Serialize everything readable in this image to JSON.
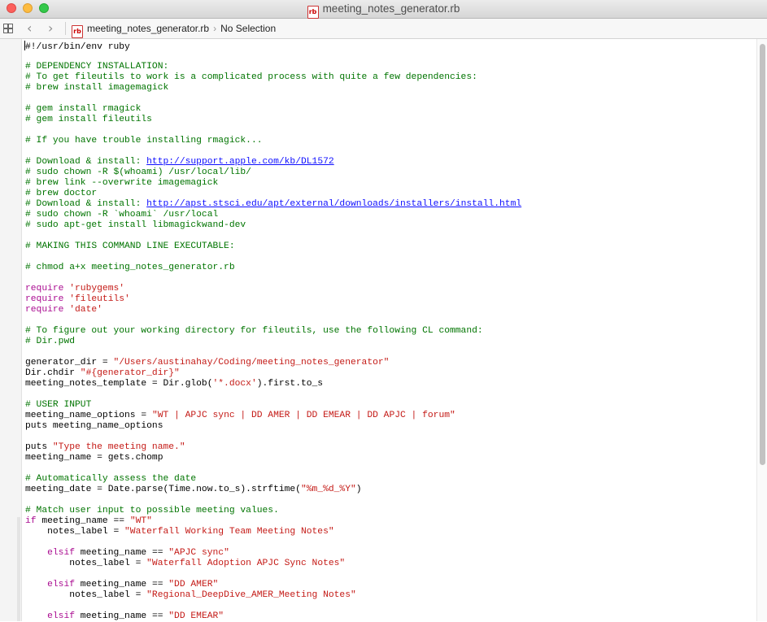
{
  "window": {
    "title": "meeting_notes_generator.rb"
  },
  "jumpbar": {
    "file": "meeting_notes_generator.rb",
    "selection": "No Selection"
  },
  "editor": {
    "lines": [
      [
        {
          "t": "p",
          "v": "#!/usr/bin/env ruby"
        }
      ],
      [],
      [
        {
          "t": "c",
          "v": "# DEPENDENCY INSTALLATION:"
        }
      ],
      [
        {
          "t": "c",
          "v": "# To get fileutils to work is a complicated process with quite a few dependencies:"
        }
      ],
      [
        {
          "t": "c",
          "v": "# brew install imagemagick"
        }
      ],
      [],
      [
        {
          "t": "c",
          "v": "# gem install rmagick"
        }
      ],
      [
        {
          "t": "c",
          "v": "# gem install fileutils"
        }
      ],
      [],
      [
        {
          "t": "c",
          "v": "# If you have trouble installing rmagick..."
        }
      ],
      [],
      [
        {
          "t": "c",
          "v": "# Download & install: "
        },
        {
          "t": "u",
          "v": "http://support.apple.com/kb/DL1572"
        }
      ],
      [
        {
          "t": "c",
          "v": "# sudo chown -R $(whoami) /usr/local/lib/"
        }
      ],
      [
        {
          "t": "c",
          "v": "# brew link --overwrite imagemagick"
        }
      ],
      [
        {
          "t": "c",
          "v": "# brew doctor"
        }
      ],
      [
        {
          "t": "c",
          "v": "# Download & install: "
        },
        {
          "t": "u",
          "v": "http://apst.stsci.edu/apt/external/downloads/installers/install.html"
        }
      ],
      [
        {
          "t": "c",
          "v": "# sudo chown -R `whoami` /usr/local"
        }
      ],
      [
        {
          "t": "c",
          "v": "# sudo apt-get install libmagickwand-dev"
        }
      ],
      [],
      [
        {
          "t": "c",
          "v": "# MAKING THIS COMMAND LINE EXECUTABLE:"
        }
      ],
      [],
      [
        {
          "t": "c",
          "v": "# chmod a+x meeting_notes_generator.rb"
        }
      ],
      [],
      [
        {
          "t": "k",
          "v": "require"
        },
        {
          "t": "p",
          "v": " "
        },
        {
          "t": "s",
          "v": "'rubygems'"
        }
      ],
      [
        {
          "t": "k",
          "v": "require"
        },
        {
          "t": "p",
          "v": " "
        },
        {
          "t": "s",
          "v": "'fileutils'"
        }
      ],
      [
        {
          "t": "k",
          "v": "require"
        },
        {
          "t": "p",
          "v": " "
        },
        {
          "t": "s",
          "v": "'date'"
        }
      ],
      [],
      [
        {
          "t": "c",
          "v": "# To figure out your working directory for fileutils, use the following CL command:"
        }
      ],
      [
        {
          "t": "c",
          "v": "# Dir.pwd"
        }
      ],
      [],
      [
        {
          "t": "p",
          "v": "generator_dir = "
        },
        {
          "t": "s",
          "v": "\"/Users/austinahay/Coding/meeting_notes_generator\""
        }
      ],
      [
        {
          "t": "p",
          "v": "Dir.chdir "
        },
        {
          "t": "s",
          "v": "\"#{generator_dir}\""
        }
      ],
      [
        {
          "t": "p",
          "v": "meeting_notes_template = Dir.glob("
        },
        {
          "t": "s",
          "v": "'*.docx'"
        },
        {
          "t": "p",
          "v": ").first.to_s"
        }
      ],
      [],
      [
        {
          "t": "c",
          "v": "# USER INPUT"
        }
      ],
      [
        {
          "t": "p",
          "v": "meeting_name_options = "
        },
        {
          "t": "s",
          "v": "\"WT | APJC sync | DD AMER | DD EMEAR | DD APJC | forum\""
        }
      ],
      [
        {
          "t": "p",
          "v": "puts meeting_name_options"
        }
      ],
      [],
      [
        {
          "t": "p",
          "v": "puts "
        },
        {
          "t": "s",
          "v": "\"Type the meeting name.\""
        }
      ],
      [
        {
          "t": "p",
          "v": "meeting_name = gets.chomp"
        }
      ],
      [],
      [
        {
          "t": "c",
          "v": "# Automatically assess the date"
        }
      ],
      [
        {
          "t": "p",
          "v": "meeting_date = Date.parse(Time.now.to_s).strftime("
        },
        {
          "t": "s",
          "v": "\"%m_%d_%Y\""
        },
        {
          "t": "p",
          "v": ")"
        }
      ],
      [],
      [
        {
          "t": "c",
          "v": "# Match user input to possible meeting values."
        }
      ],
      [
        {
          "t": "k",
          "v": "if"
        },
        {
          "t": "p",
          "v": " meeting_name == "
        },
        {
          "t": "s",
          "v": "\"WT\""
        }
      ],
      [
        {
          "t": "p",
          "v": "    notes_label = "
        },
        {
          "t": "s",
          "v": "\"Waterfall Working Team Meeting Notes\""
        }
      ],
      [],
      [
        {
          "t": "p",
          "v": "    "
        },
        {
          "t": "k",
          "v": "elsif"
        },
        {
          "t": "p",
          "v": " meeting_name == "
        },
        {
          "t": "s",
          "v": "\"APJC sync\""
        }
      ],
      [
        {
          "t": "p",
          "v": "        notes_label = "
        },
        {
          "t": "s",
          "v": "\"Waterfall Adoption APJC Sync Notes\""
        }
      ],
      [],
      [
        {
          "t": "p",
          "v": "    "
        },
        {
          "t": "k",
          "v": "elsif"
        },
        {
          "t": "p",
          "v": " meeting_name == "
        },
        {
          "t": "s",
          "v": "\"DD AMER\""
        }
      ],
      [
        {
          "t": "p",
          "v": "        notes_label = "
        },
        {
          "t": "s",
          "v": "\"Regional_DeepDive_AMER_Meeting Notes\""
        }
      ],
      [],
      [
        {
          "t": "p",
          "v": "    "
        },
        {
          "t": "k",
          "v": "elsif"
        },
        {
          "t": "p",
          "v": " meeting_name == "
        },
        {
          "t": "s",
          "v": "\"DD EMEAR\""
        }
      ]
    ]
  }
}
